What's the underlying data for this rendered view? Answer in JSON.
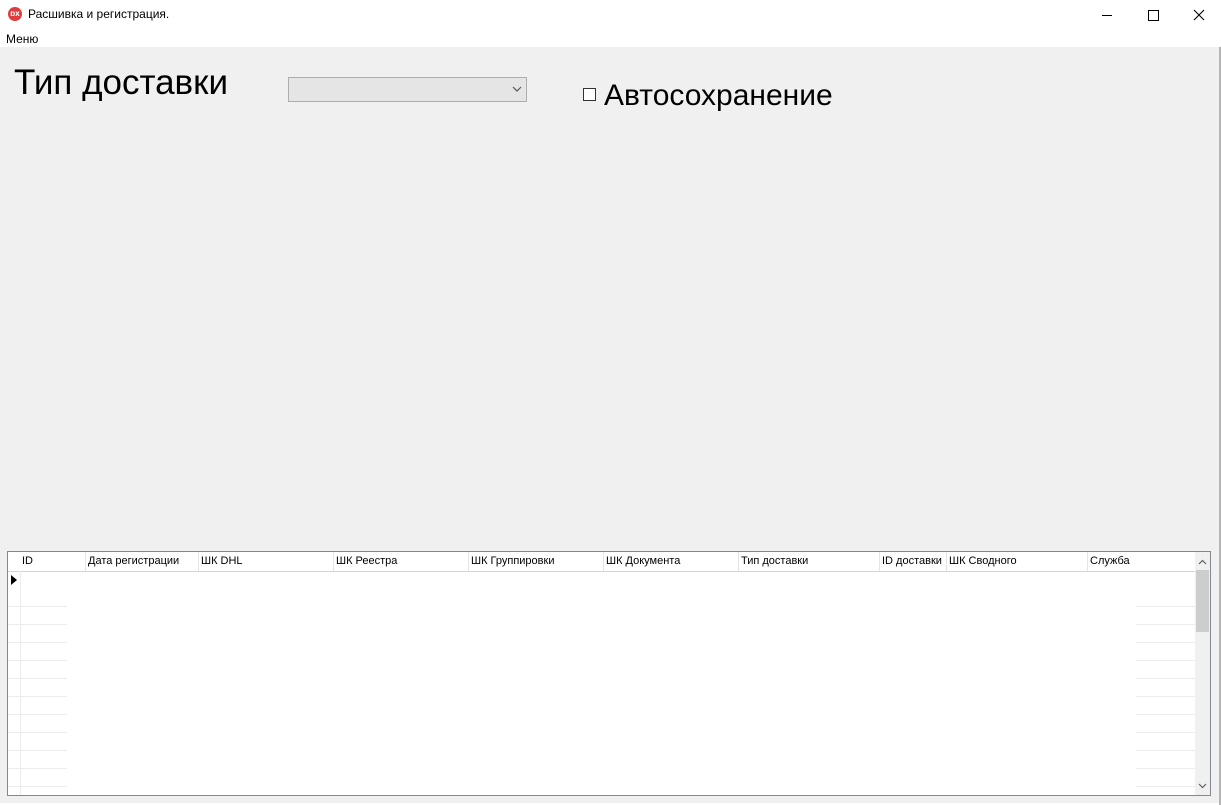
{
  "window": {
    "title": "Расшивка и регистрация.",
    "icon_text": "DX",
    "icon_color": "#e03c3c"
  },
  "menu": {
    "items": [
      "Меню"
    ]
  },
  "form": {
    "delivery_type_label": "Тип доставки",
    "delivery_type_value": "",
    "autosave_label": "Автосохранение",
    "autosave_checked": false
  },
  "grid": {
    "columns": [
      "ID",
      "Дата регистрации",
      "ШК DHL",
      "ШК Реестра",
      "ШК Группировки",
      "ШК Документа",
      "Тип доставки",
      "ID доставки",
      "ШК Сводного",
      "Служба"
    ],
    "rows": []
  },
  "colors": {
    "client_background": "#f0f0f0",
    "grid_background": "#ffffff"
  }
}
